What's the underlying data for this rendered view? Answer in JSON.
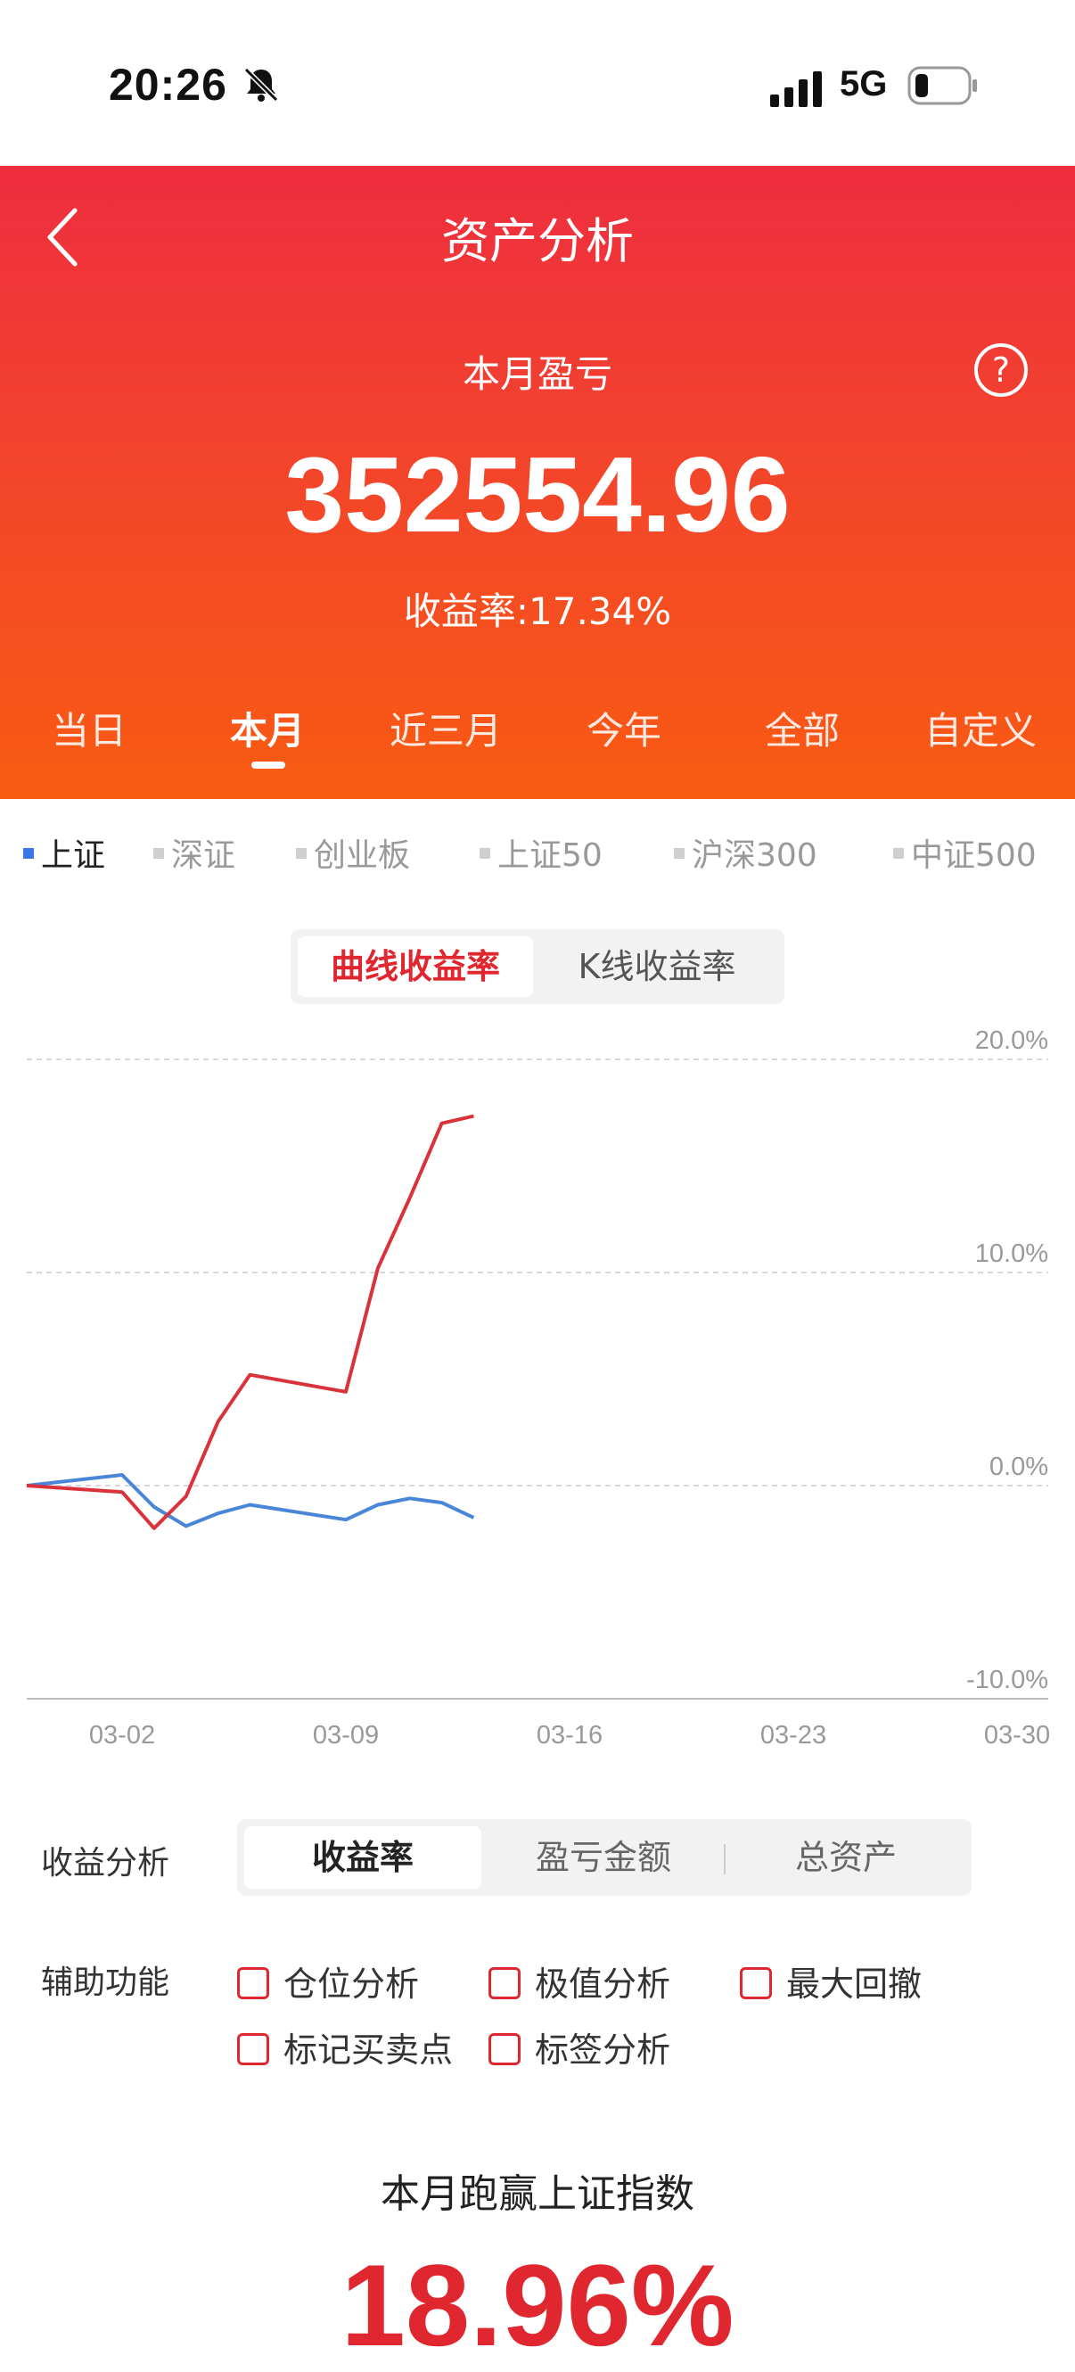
{
  "status_bar": {
    "time": "20:26",
    "network": "5G",
    "icons": [
      "bell-off-icon",
      "signal-icon",
      "battery-icon"
    ]
  },
  "header": {
    "title": "资产分析",
    "profit_label": "本月盈亏",
    "profit_value": "352554.96",
    "rate_text": "收益率:17.34%",
    "tabs": [
      "当日",
      "本月",
      "近三月",
      "今年",
      "全部",
      "自定义"
    ],
    "active_tab": "本月",
    "colors": {
      "top": "#ee2d3f",
      "bottom": "#f95b12"
    }
  },
  "index_filters": {
    "items": [
      "上证",
      "深证",
      "创业板",
      "上证50",
      "沪深300",
      "中证500"
    ],
    "active": "上证",
    "active_color": "#3b78e7"
  },
  "chart_mode": {
    "options": [
      "曲线收益率",
      "K线收益率"
    ],
    "active": "曲线收益率"
  },
  "chart_data": {
    "type": "line",
    "x_labels": [
      "03-02",
      "03-09",
      "03-16",
      "03-23",
      "03-30"
    ],
    "y_labels": [
      "20.0%",
      "10.0%",
      "0.0%",
      "-10.0%"
    ],
    "ylim": [
      -10,
      20
    ],
    "series": [
      {
        "name": "",
        "color": "#d9323a",
        "x": [
          "02-27",
          "03-02",
          "03-03",
          "03-04",
          "03-05",
          "03-06",
          "03-09",
          "03-10",
          "03-11",
          "03-12",
          "03-13"
        ],
        "values": [
          0.0,
          -0.3,
          -2.0,
          -0.5,
          3.0,
          5.2,
          4.4,
          10.2,
          13.5,
          17.0,
          17.34
        ]
      },
      {
        "name": "",
        "color": "#4a86d8",
        "x": [
          "02-27",
          "03-02",
          "03-03",
          "03-04",
          "03-05",
          "03-06",
          "03-09",
          "03-10",
          "03-11",
          "03-12",
          "03-13"
        ],
        "values": [
          0.0,
          0.5,
          -1.0,
          -1.9,
          -1.3,
          -0.9,
          -1.6,
          -0.9,
          -0.6,
          -0.8,
          -1.5
        ]
      }
    ]
  },
  "analysis": {
    "label": "收益分析",
    "options": [
      "收益率",
      "盈亏金额",
      "总资产"
    ],
    "active": "收益率"
  },
  "aux": {
    "label": "辅助功能",
    "options": [
      "仓位分析",
      "极值分析",
      "最大回撤",
      "标记买卖点",
      "标签分析"
    ]
  },
  "beat": {
    "title": "本月跑赢上证指数",
    "value": "18.96%"
  }
}
